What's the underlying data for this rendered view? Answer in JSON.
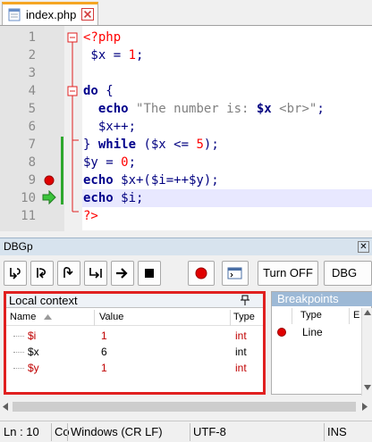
{
  "tab": {
    "filename": "index.php"
  },
  "editor": {
    "line_numbers": [
      "1",
      "2",
      "3",
      "4",
      "5",
      "6",
      "7",
      "8",
      "9",
      "10",
      "11"
    ],
    "lines": [
      [
        {
          "t": "<?php",
          "c": "php-tag"
        }
      ],
      [
        {
          "t": " $x",
          "c": "var"
        },
        {
          "t": " = ",
          "c": "op"
        },
        {
          "t": "1",
          "c": "num"
        },
        {
          "t": ";",
          "c": "op"
        }
      ],
      [],
      [
        {
          "t": "do",
          "c": "kw"
        },
        {
          "t": " {",
          "c": "op"
        }
      ],
      [
        {
          "t": "  echo ",
          "c": "kw"
        },
        {
          "t": "\"The number is: ",
          "c": "str"
        },
        {
          "t": "$x",
          "c": "strvar"
        },
        {
          "t": " <br>\"",
          "c": "str"
        },
        {
          "t": ";",
          "c": "op"
        }
      ],
      [
        {
          "t": "  $x++;",
          "c": "var"
        }
      ],
      [
        {
          "t": "} ",
          "c": "op"
        },
        {
          "t": "while",
          "c": "kw"
        },
        {
          "t": " (",
          "c": "op"
        },
        {
          "t": "$x",
          "c": "var"
        },
        {
          "t": " <= ",
          "c": "op"
        },
        {
          "t": "5",
          "c": "num"
        },
        {
          "t": ");",
          "c": "op"
        }
      ],
      [
        {
          "t": "$y",
          "c": "var"
        },
        {
          "t": " = ",
          "c": "op"
        },
        {
          "t": "0",
          "c": "num"
        },
        {
          "t": ";",
          "c": "op"
        }
      ],
      [
        {
          "t": "echo",
          "c": "kw"
        },
        {
          "t": " $x+($i=++$y);",
          "c": "var"
        }
      ],
      [
        {
          "t": "echo",
          "c": "kw"
        },
        {
          "t": " $i;",
          "c": "var"
        }
      ],
      [
        {
          "t": "?>",
          "c": "php-tag"
        }
      ]
    ],
    "current_line": "10",
    "breakpoint_line": "9"
  },
  "dbgp": {
    "title": "DBGp",
    "close_glyph": "✕",
    "turn_off_label": "Turn OFF",
    "dbg_label": "DBG"
  },
  "local_context": {
    "title": "Local context",
    "columns": {
      "name": "Name",
      "value": "Value",
      "type": "Type"
    },
    "rows": [
      {
        "name": "$i",
        "value": "1",
        "type": "int",
        "changed": true
      },
      {
        "name": "$x",
        "value": "6",
        "type": "int",
        "changed": false
      },
      {
        "name": "$y",
        "value": "1",
        "type": "int",
        "changed": true
      }
    ]
  },
  "breakpoints": {
    "title": "Breakpoints",
    "columns": {
      "type": "Type",
      "extra": "E"
    },
    "rows": [
      {
        "type": "Line"
      }
    ]
  },
  "status": {
    "ln": "Ln : 10",
    "col": "Co",
    "eol": "Windows (CR LF)",
    "encoding": "UTF-8",
    "mode": "INS"
  },
  "colors": {
    "highlight_border": "#e02020",
    "current_line_bg": "#e8e8ff",
    "breakpoint": "#e00000",
    "changed_value": "#c00000"
  }
}
